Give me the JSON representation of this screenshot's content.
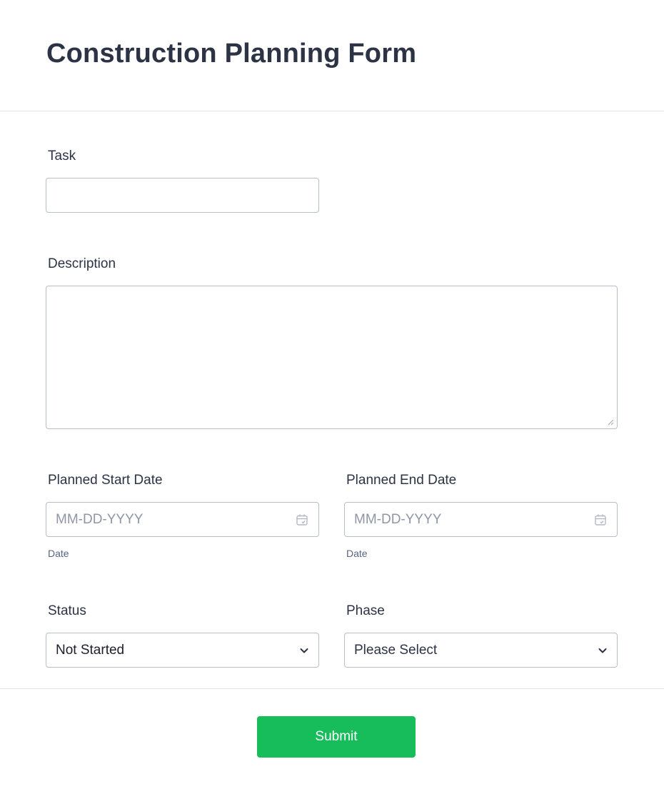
{
  "form": {
    "title": "Construction Planning Form"
  },
  "fields": {
    "task": {
      "label": "Task",
      "value": ""
    },
    "description": {
      "label": "Description",
      "value": ""
    },
    "start_date": {
      "label": "Planned Start Date",
      "placeholder": "MM-DD-YYYY",
      "sublabel": "Date"
    },
    "end_date": {
      "label": "Planned End Date",
      "placeholder": "MM-DD-YYYY",
      "sublabel": "Date"
    },
    "status": {
      "label": "Status",
      "selected": "Not Started"
    },
    "phase": {
      "label": "Phase",
      "selected": "Please Select"
    }
  },
  "actions": {
    "submit_label": "Submit"
  },
  "colors": {
    "accent": "#18bd5b",
    "text": "#2c3345",
    "border": "#b8bdc9"
  },
  "icons": [
    "calendar-icon",
    "chevron-down-icon",
    "resize-grip-icon"
  ]
}
